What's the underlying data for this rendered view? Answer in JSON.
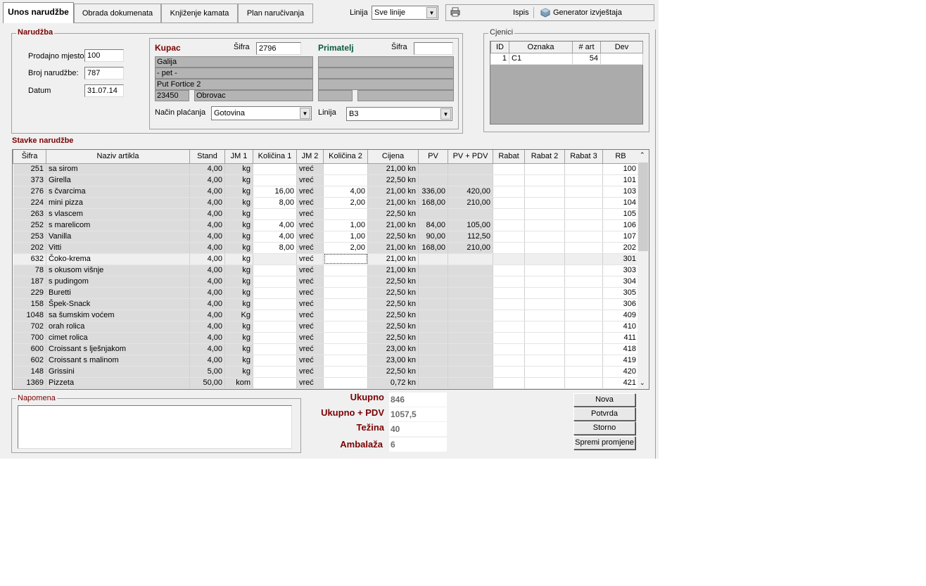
{
  "tabs": [
    "Unos narudžbe",
    "Obrada dokumenata",
    "Knjiženje kamata",
    "Plan naručivanja"
  ],
  "top": {
    "linija_label": "Linija",
    "linija_value": "Sve linije",
    "ispis": "Ispis",
    "generator": "Generator izvještaja"
  },
  "narudzba": {
    "title": "Narudžba",
    "prodajno_label": "Prodajno mjesto",
    "prodajno": "100",
    "broj_label": "Broj narudžbe:",
    "broj": "787",
    "datum_label": "Datum",
    "datum": "31.07.14"
  },
  "kupac": {
    "title": "Kupac",
    "sifra_label": "Šifra",
    "sifra": "2796",
    "line1": "Galija",
    "line2": "- pet -",
    "line3": "Put Fortice 2",
    "zip": "23450",
    "city": "Obrovac",
    "placanje_label": "Način plaćanja",
    "placanje": "Gotovina"
  },
  "primatelj": {
    "title": "Primatelj",
    "sifra_label": "Šifra",
    "sifra": "",
    "linija_label": "Linija",
    "linija": "B3"
  },
  "cjenici": {
    "title": "Cjenici",
    "headers": [
      "ID",
      "Oznaka",
      "# art",
      "Dev"
    ],
    "rows": [
      {
        "id": "1",
        "oznaka": "C1",
        "art": "54",
        "dev": ""
      }
    ]
  },
  "stavke": {
    "title": "Stavke narudžbe",
    "headers": [
      "Šifra",
      "Naziv artikla",
      "Stand",
      "JM 1",
      "Količina 1",
      "JM 2",
      "Količina 2",
      "Cijena",
      "PV",
      "PV + PDV",
      "Rabat",
      "Rabat 2",
      "Rabat 3",
      "RB"
    ],
    "rows": [
      [
        "251",
        "sa sirom",
        "4,00",
        "kg",
        "",
        "vreć",
        "",
        "21,00 kn",
        "",
        "",
        "",
        "",
        "",
        "100"
      ],
      [
        "373",
        "Girella",
        "4,00",
        "kg",
        "",
        "vreć",
        "",
        "22,50 kn",
        "",
        "",
        "",
        "",
        "",
        "101"
      ],
      [
        "276",
        "s čvarcima",
        "4,00",
        "kg",
        "16,00",
        "vreć",
        "4,00",
        "21,00 kn",
        "336,00",
        "420,00",
        "",
        "",
        "",
        "103"
      ],
      [
        "224",
        "mini pizza",
        "4,00",
        "kg",
        "8,00",
        "vreć",
        "2,00",
        "21,00 kn",
        "168,00",
        "210,00",
        "",
        "",
        "",
        "104"
      ],
      [
        "263",
        "s vlascem",
        "4,00",
        "kg",
        "",
        "vreć",
        "",
        "22,50 kn",
        "",
        "",
        "",
        "",
        "",
        "105"
      ],
      [
        "252",
        "s marelicom",
        "4,00",
        "kg",
        "4,00",
        "vreć",
        "1,00",
        "21,00 kn",
        "84,00",
        "105,00",
        "",
        "",
        "",
        "106"
      ],
      [
        "253",
        "Vanilla",
        "4,00",
        "kg",
        "4,00",
        "vreć",
        "1,00",
        "22,50 kn",
        "90,00",
        "112,50",
        "",
        "",
        "",
        "107"
      ],
      [
        "202",
        "Vitti",
        "4,00",
        "kg",
        "8,00",
        "vreć",
        "2,00",
        "21,00 kn",
        "168,00",
        "210,00",
        "",
        "",
        "",
        "202"
      ],
      [
        "632",
        "Čoko-krema",
        "4,00",
        "kg",
        "",
        "vreć",
        "",
        "21,00 kn",
        "",
        "",
        "",
        "",
        "",
        "301"
      ],
      [
        "78",
        "s okusom višnje",
        "4,00",
        "kg",
        "",
        "vreć",
        "",
        "21,00 kn",
        "",
        "",
        "",
        "",
        "",
        "303"
      ],
      [
        "187",
        "s pudingom",
        "4,00",
        "kg",
        "",
        "vreć",
        "",
        "22,50 kn",
        "",
        "",
        "",
        "",
        "",
        "304"
      ],
      [
        "229",
        "Buretti",
        "4,00",
        "kg",
        "",
        "vreć",
        "",
        "22,50 kn",
        "",
        "",
        "",
        "",
        "",
        "305"
      ],
      [
        "158",
        "Špek-Snack",
        "4,00",
        "kg",
        "",
        "vreć",
        "",
        "22,50 kn",
        "",
        "",
        "",
        "",
        "",
        "306"
      ],
      [
        "1048",
        "sa šumskim voćem",
        "4,00",
        "Kg",
        "",
        "vreć",
        "",
        "22,50 kn",
        "",
        "",
        "",
        "",
        "",
        "409"
      ],
      [
        "702",
        "orah rolica",
        "4,00",
        "kg",
        "",
        "vreć",
        "",
        "22,50 kn",
        "",
        "",
        "",
        "",
        "",
        "410"
      ],
      [
        "700",
        "cimet rolica",
        "4,00",
        "kg",
        "",
        "vreć",
        "",
        "22,50 kn",
        "",
        "",
        "",
        "",
        "",
        "411"
      ],
      [
        "600",
        "Croissant s lješnjakom",
        "4,00",
        "kg",
        "",
        "vreć",
        "",
        "23,00 kn",
        "",
        "",
        "",
        "",
        "",
        "418"
      ],
      [
        "602",
        "Croissant s malinom",
        "4,00",
        "kg",
        "",
        "vreć",
        "",
        "23,00 kn",
        "",
        "",
        "",
        "",
        "",
        "419"
      ],
      [
        "148",
        "Grissini",
        "5,00",
        "kg",
        "",
        "vreć",
        "",
        "22,50 kn",
        "",
        "",
        "",
        "",
        "",
        "420"
      ],
      [
        "1369",
        "Pizzeta",
        "50,00",
        "kom",
        "",
        "vreć",
        "",
        "0,72 kn",
        "",
        "",
        "",
        "",
        "",
        "421"
      ]
    ]
  },
  "napomena": {
    "title": "Napomena",
    "text": ""
  },
  "totals": {
    "ukupno_label": "Ukupno",
    "ukupno": "846",
    "ukupno_pdv_label": "Ukupno + PDV",
    "ukupno_pdv": "1057,5",
    "tezina_label": "Težina",
    "tezina": "40",
    "ambalaza_label": "Ambalaža",
    "ambalaza": "6"
  },
  "buttons": {
    "nova": "Nova",
    "potvrda": "Potvrda",
    "storno": "Storno",
    "spremi": "Spremi promjene"
  }
}
